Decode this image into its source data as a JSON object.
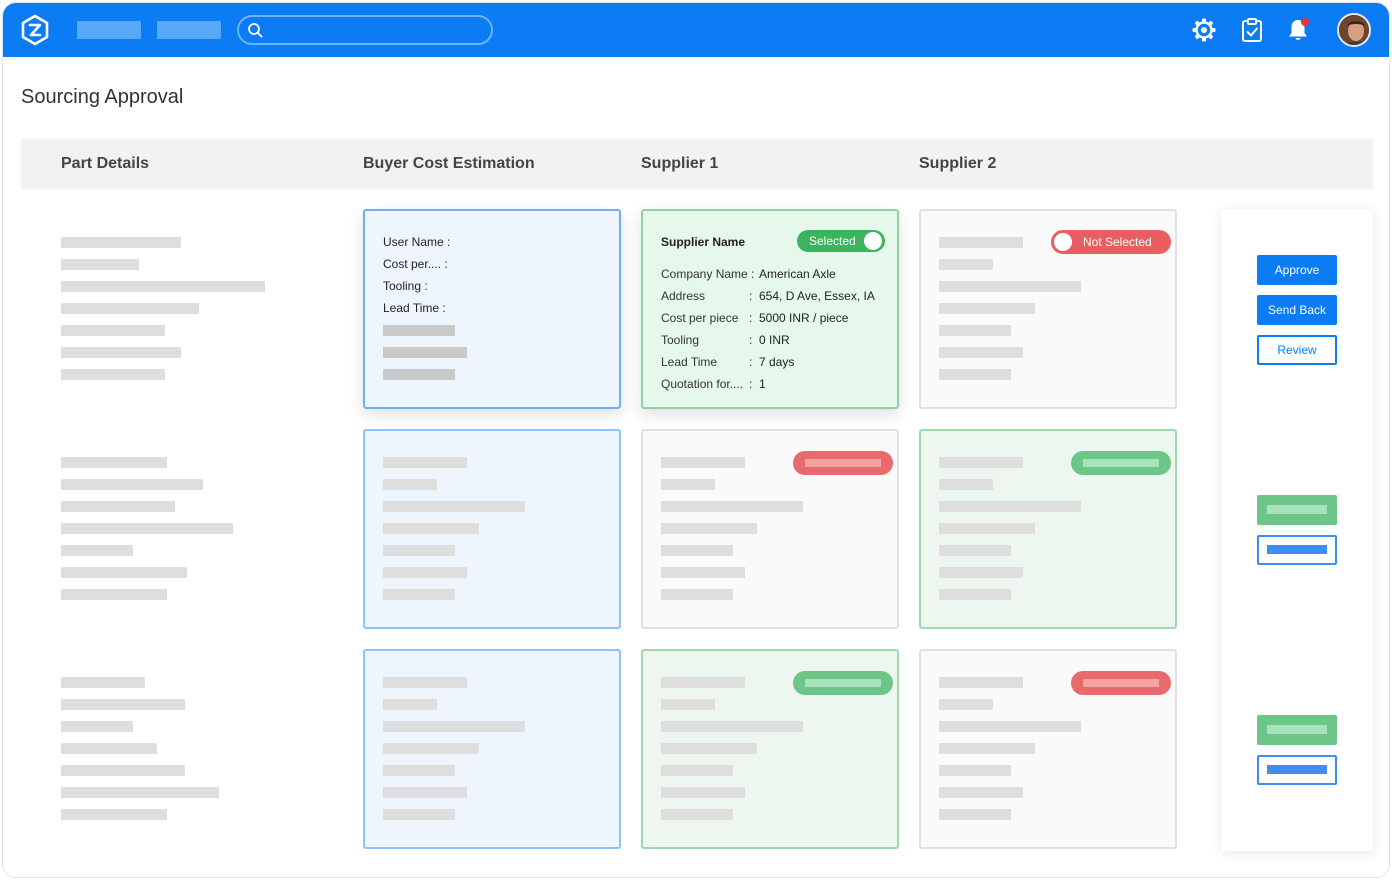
{
  "page": {
    "title": "Sourcing Approval"
  },
  "table_headers": {
    "part_details": "Part Details",
    "buyer_cost_estimation": "Buyer Cost Estimation",
    "supplier_1": "Supplier 1",
    "supplier_2": "Supplier 2"
  },
  "buyer_card": {
    "user_name_label": "User Name :",
    "cost_label": "Cost per....   :",
    "tooling_label": "Tooling  :",
    "lead_time_label": "Lead Time   :"
  },
  "supplier1_card": {
    "header": "Supplier Name",
    "toggle_label": "Selected",
    "rows": [
      {
        "label": "Company Name :",
        "value": "American Axle"
      },
      {
        "label": "Address",
        "sep": ":",
        "value": "654,  D Ave, Essex, IA"
      },
      {
        "label": "Cost per piece",
        "sep": ":",
        "value": "5000 INR / piece"
      },
      {
        "label": "Tooling",
        "sep": ":",
        "value": "0 INR"
      },
      {
        "label": "Lead Time",
        "sep": ":",
        "value": "7 days"
      },
      {
        "label": "Quotation for....",
        "sep": ":",
        "value": "1"
      }
    ]
  },
  "supplier2_card": {
    "toggle_label": "Not Selected"
  },
  "actions": {
    "approve": "Approve",
    "send_back": "Send Back",
    "review": "Review"
  },
  "colors": {
    "brand_blue": "#0b7cf4",
    "selected_green": "#3bb45d",
    "not_selected_red": "#e95e60"
  },
  "icons": {
    "logo": "app-logo-icon",
    "search": "search-icon",
    "settings": "gear-icon",
    "tasks": "clipboard-check-icon",
    "notifications": "bell-icon",
    "profile": "avatar"
  }
}
